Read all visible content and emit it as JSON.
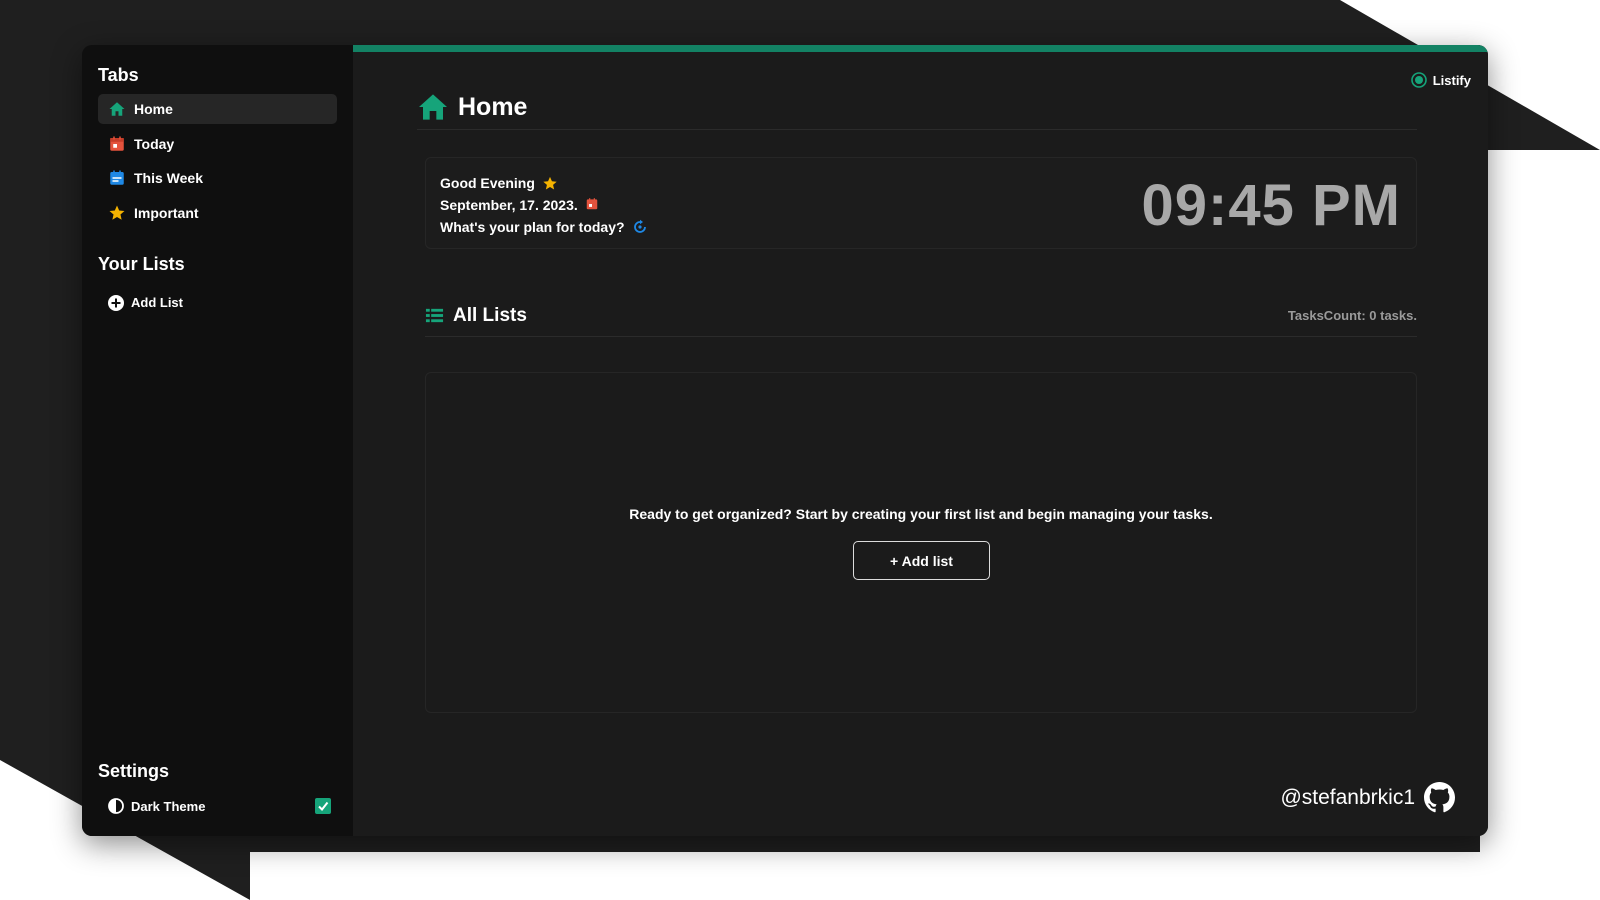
{
  "sidebar": {
    "tabs_title": "Tabs",
    "tabs": [
      {
        "label": "Home",
        "icon": "home-icon",
        "color": "#16a47a",
        "active": true
      },
      {
        "label": "Today",
        "icon": "calendar-today-icon",
        "color": "#e5533d",
        "active": false
      },
      {
        "label": "This Week",
        "icon": "calendar-week-icon",
        "color": "#1e88e5",
        "active": false
      },
      {
        "label": "Important",
        "icon": "star-icon",
        "color": "#f5b301",
        "active": false
      }
    ],
    "lists_title": "Your Lists",
    "add_list_label": "Add List",
    "settings_title": "Settings",
    "dark_theme_label": "Dark Theme",
    "dark_theme_checked": true
  },
  "header": {
    "brand": "Listify",
    "page_title": "Home",
    "accent": "#138264"
  },
  "greeting": {
    "line1": "Good Evening",
    "line2": "September, 17. 2023.",
    "line3": "What's your plan for today?",
    "clock": "09:45 PM"
  },
  "lists": {
    "title": "All Lists",
    "tasks_count": "TasksCount: 0 tasks.",
    "empty_message": "Ready to get organized? Start by creating your first list and begin managing your tasks.",
    "add_button_label": "+ Add list"
  },
  "footer": {
    "handle": "@stefanbrkic1",
    "icon": "github-icon"
  }
}
